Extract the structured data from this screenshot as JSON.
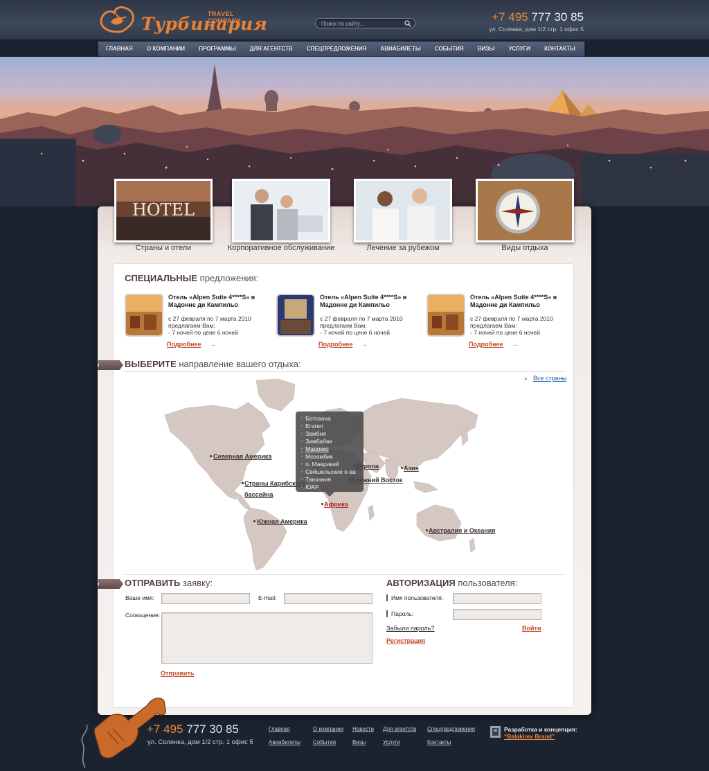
{
  "header": {
    "brand_name": "Турбинария",
    "brand_tagline": "TRAVEL COMPANY",
    "search_placeholder": "Поиск по сайту...",
    "phone_code": "+7 495",
    "phone_number": "777 30 85",
    "address": "ул. Солянка, дом 1/2 стр. 1 офис 5"
  },
  "nav": {
    "items": [
      "Главная",
      "О компании",
      "Программы",
      "Для агентств",
      "Спецпредложения",
      "Авиабилеты",
      "События",
      "Визы",
      "Услуги",
      "Контакты"
    ]
  },
  "categories": [
    {
      "label": "Страны и отели",
      "image_text": "HOTEL"
    },
    {
      "label": "Корпоративное обслуживание"
    },
    {
      "label": "Лечение за рубежом"
    },
    {
      "label": "Виды отдыха"
    }
  ],
  "specials": {
    "title_bold": "Специальные",
    "title_rest": " предложения:",
    "offers": [
      {
        "title": "Отель «Alpen Suite 4****S» в Мадонне ди Кампильо",
        "text_line1": "с 27 февраля по 7 марта 2010",
        "text_line2": "предлагаем Вам:",
        "text_line3": "- 7 ночей по цене 6 ночей",
        "more": "Подробнее",
        "arrow": "→"
      },
      {
        "title": "Отель «Alpen Suite 4****S» в Мадонне ди Кампильо",
        "text_line1": "с 27 февраля по 7 марта 2010",
        "text_line2": "предлагаем Вам:",
        "text_line3": "- 7 ночей по цене 6 ночей",
        "more": "Подробнее",
        "arrow": "→"
      },
      {
        "title": "Отель «Alpen Suite 4****S» в Мадонне ди Кампильо",
        "text_line1": "с 27 февраля по 7 марта 2010",
        "text_line2": "предлагаем Вам:",
        "text_line3": "- 7 ночей по цене 6 ночей",
        "more": "Подробнее",
        "arrow": "→"
      }
    ]
  },
  "destinations": {
    "title_bold": "Выберите",
    "title_rest": " направление вашего отдыха:",
    "all_countries": "Все страны",
    "regions": {
      "north_america": "Северная Америка",
      "caribbean_1": "Страны Карибского",
      "caribbean_2": "бассейна",
      "south_america": "Южная Америка",
      "europe": "Европа",
      "middle_east": "Ближний Восток",
      "asia": "Азия",
      "africa": "Африка",
      "oceania": "Австралия и Океания"
    },
    "africa_countries": [
      "Ботсвана",
      "Египет",
      "Замбия",
      "Зимбабве",
      "Марокко",
      "Мозамбик",
      "о. Маврикий",
      "Сейшельские о-ва",
      "Танзания",
      "ЮАР"
    ],
    "active_country": "Марокко"
  },
  "request_form": {
    "title_bold": "Отправить",
    "title_rest": " заявку:",
    "name_label": "Ваше имя:",
    "email_label": "E-mail:",
    "message_label": "Сооющение:",
    "submit": "Отправить"
  },
  "auth": {
    "title_bold": "Авторизация",
    "title_rest": " пользователя:",
    "username_label": "Имя пользователя:",
    "password_label": "Пароль:",
    "forgot": "Забыли пароль?",
    "login": "Войти",
    "register": "Регистрация"
  },
  "footer": {
    "phone_code": "+7 495",
    "phone_number": "777 30 85",
    "address": "ул. Солянка, дом 1/2 стр. 1 офис 5",
    "links_row1": [
      "Главная",
      "О компании",
      "Новости",
      "Для агентств",
      "Спецпредложения"
    ],
    "links_row2": [
      "Авиабилеты",
      "События",
      "Визы",
      "Услуги",
      "Контакты"
    ],
    "dev_label": "Разработка и концепция:",
    "dev_name": "“Balakirev Brand”"
  },
  "colors": {
    "accent_orange": "#e8823a",
    "link_red": "#c24a28",
    "header_bg": "#3d485a",
    "page_bg": "#1b2330",
    "map_land": "#d5c8c2"
  }
}
